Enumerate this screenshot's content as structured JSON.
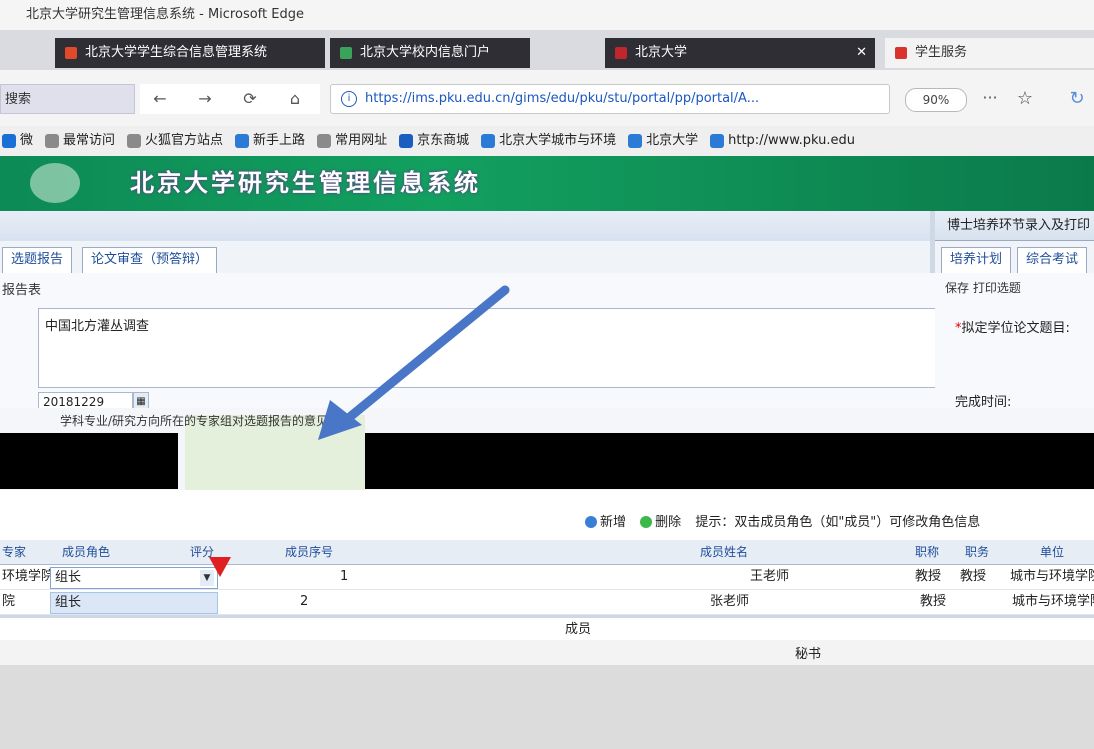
{
  "window": {
    "title": "北京大学研究生管理信息系统 - Microsoft Edge"
  },
  "tabs": [
    {
      "label": "北京大学学生综合信息管理系统",
      "style": "dark",
      "icon_color": "#e04a2a"
    },
    {
      "label": "北京大学校内信息门户",
      "style": "dark",
      "icon_color": "#3aa35a"
    },
    {
      "label": "北京大学",
      "style": "dark",
      "icon_color": "#c0262c"
    },
    {
      "label": "学生服务",
      "style": "light",
      "icon_color": "#d9342b"
    }
  ],
  "urlbar": {
    "search_label": "搜索",
    "url": "https://ims.pku.edu.cn/gims/edu/pku/stu/portal/pp/portal/A...",
    "zoom": "90%",
    "more_icon": "ellipsis-icon",
    "star_icon": "star-icon"
  },
  "bookmarks": [
    {
      "label": "微",
      "icon_color": "#1a6fd6"
    },
    {
      "label": "最常访问",
      "icon_color": "#8a8a8a"
    },
    {
      "label": "火狐官方站点",
      "icon_color": "#8a8a8a"
    },
    {
      "label": "新手上路",
      "icon_color": "#2a7ad6"
    },
    {
      "label": "常用网址",
      "icon_color": "#8a8a8a"
    },
    {
      "label": "京东商城",
      "icon_color": "#1a5fbf"
    },
    {
      "label": "北京大学城市与环境",
      "icon_color": "#2a7ad6"
    },
    {
      "label": "北京大学",
      "icon_color": "#2a7ad6"
    },
    {
      "label": "http://www.pku.edu",
      "icon_color": "#2a7ad6"
    }
  ],
  "banner": {
    "title": "北京大学研究生管理信息系统"
  },
  "left_panel": {
    "subtabs": [
      "选题报告",
      "论文审查（预答辩）"
    ],
    "form_label": "报告表",
    "topic_value": "中国北方灌丛调查",
    "date_value": "20181229"
  },
  "right_panel": {
    "header": "博士培养环节录入及打印",
    "subtabs": [
      "培养计划",
      "综合考试"
    ],
    "toolbar_label": "保存 打印选题",
    "field1_label": "拟定学位论文题目:",
    "field2_label": "完成时间:"
  },
  "hint_row": {
    "mid_text": "学科专业/研究方向所在的专家组对选题报告的意见"
  },
  "grid": {
    "toolbar": {
      "add": "新增",
      "delete": "删除",
      "hint": "提示：双击成员角色（如\"成员\"）可修改角色信息"
    },
    "headers_left": [
      "专家",
      "成员角色",
      "评分",
      "成员序号"
    ],
    "headers_right": [
      "成员姓名",
      "职称",
      "职务",
      "单位"
    ],
    "rows": [
      {
        "prefix": "环境学院",
        "role": "组长",
        "seq": "1",
        "name": "王老师",
        "title": "教授",
        "post": "教授",
        "unit": "城市与环境学院"
      },
      {
        "prefix": "院",
        "role": "组长",
        "seq": "2",
        "name": "张老师",
        "title": "教授",
        "post": "",
        "unit": "城市与环境学院"
      }
    ],
    "member_label": "成员",
    "secretary_label": "秘书"
  },
  "colors": {
    "banner_green": "#0d8a55",
    "arrow_blue": "#4a76c7",
    "arrow_red": "#e02020",
    "link_blue": "#1e4d9b"
  }
}
